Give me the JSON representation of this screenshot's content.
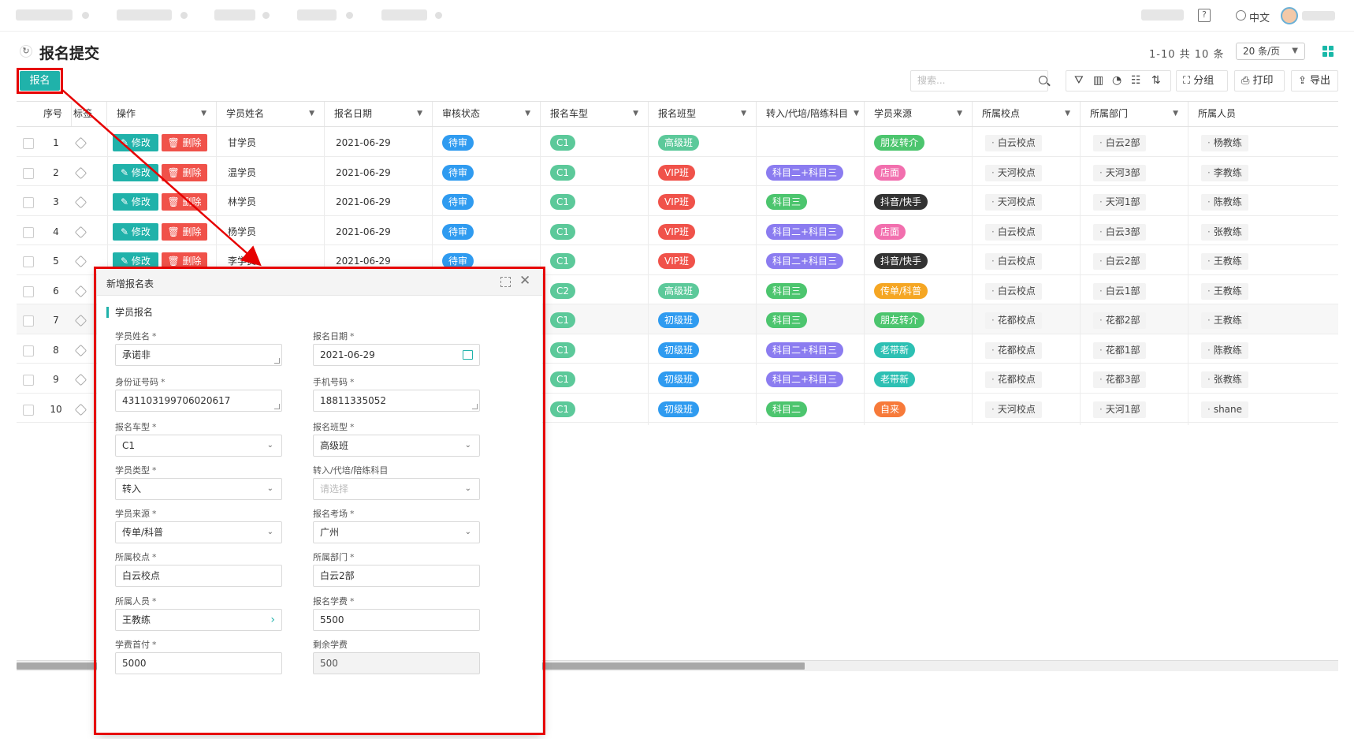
{
  "header": {
    "language": "中文",
    "help_glyph": "?"
  },
  "page": {
    "title": "报名提交",
    "paging_info": "1-10 共 10 条",
    "page_size": "20 条/页",
    "register_button": "报名"
  },
  "toolbar": {
    "search_placeholder": "搜索...",
    "group_label": "分组",
    "print_label": "打印",
    "export_label": "导出"
  },
  "table": {
    "columns": [
      "序号",
      "标签",
      "操作",
      "学员姓名",
      "报名日期",
      "审核状态",
      "报名车型",
      "报名班型",
      "转入/代培/陪练科目",
      "学员来源",
      "所属校点",
      "所属部门",
      "所属人员"
    ],
    "edit_label": "修改",
    "delete_label": "删除",
    "rows": [
      {
        "no": "1",
        "name": "甘学员",
        "date": "2021-06-29",
        "status": "待审",
        "car": "C1",
        "class": "高级班",
        "subject": "",
        "source": "朋友转介",
        "school": "白云校点",
        "dept": "白云2部",
        "person": "杨教练"
      },
      {
        "no": "2",
        "name": "温学员",
        "date": "2021-06-29",
        "status": "待审",
        "car": "C1",
        "class": "VIP班",
        "subject": "科目二+科目三",
        "source": "店面",
        "school": "天河校点",
        "dept": "天河3部",
        "person": "李教练"
      },
      {
        "no": "3",
        "name": "林学员",
        "date": "2021-06-29",
        "status": "待审",
        "car": "C1",
        "class": "VIP班",
        "subject": "科目三",
        "source": "抖音/快手",
        "school": "天河校点",
        "dept": "天河1部",
        "person": "陈教练"
      },
      {
        "no": "4",
        "name": "杨学员",
        "date": "2021-06-29",
        "status": "待审",
        "car": "C1",
        "class": "VIP班",
        "subject": "科目二+科目三",
        "source": "店面",
        "school": "白云校点",
        "dept": "白云3部",
        "person": "张教练"
      },
      {
        "no": "5",
        "name": "李学员",
        "date": "2021-06-29",
        "status": "待审",
        "car": "C1",
        "class": "VIP班",
        "subject": "科目二+科目三",
        "source": "抖音/快手",
        "school": "白云校点",
        "dept": "白云2部",
        "person": "王教练"
      },
      {
        "no": "6",
        "car": "C2",
        "class": "高级班",
        "subject": "科目三",
        "source": "传单/科普",
        "school": "白云校点",
        "dept": "白云1部",
        "person": "王教练"
      },
      {
        "no": "7",
        "car": "C1",
        "class": "初级班",
        "subject": "科目三",
        "source": "朋友转介",
        "school": "花都校点",
        "dept": "花都2部",
        "person": "王教练"
      },
      {
        "no": "8",
        "car": "C1",
        "class": "初级班",
        "subject": "科目二+科目三",
        "source": "老带新",
        "school": "花都校点",
        "dept": "花都1部",
        "person": "陈教练"
      },
      {
        "no": "9",
        "car": "C1",
        "class": "初级班",
        "subject": "科目二+科目三",
        "source": "老带新",
        "school": "花都校点",
        "dept": "花都3部",
        "person": "张教练"
      },
      {
        "no": "10",
        "car": "C1",
        "class": "初级班",
        "subject": "科目二",
        "source": "自来",
        "school": "天河校点",
        "dept": "天河1部",
        "person": "shane"
      }
    ]
  },
  "colors": {
    "teal": "#20b2aa",
    "red": "#f0524a",
    "vip": "#f0524a",
    "advanced": "#5cc99a",
    "beginner": "#2f9bf0",
    "subject": "#8b7cf0",
    "friend": "#4cc56e",
    "store": "#f26fae",
    "douyin": "#333333",
    "flyer": "#f5a623",
    "oldnew": "#2dc0b3",
    "self": "#f77a3a"
  },
  "dialog": {
    "title": "新增报名表",
    "section": "学员报名",
    "fields": {
      "name_label": "学员姓名",
      "name_value": "承诺非",
      "date_label": "报名日期",
      "date_value": "2021-06-29",
      "id_label": "身份证号码",
      "id_value": "431103199706020617",
      "phone_label": "手机号码",
      "phone_value": "18811335052",
      "car_label": "报名车型",
      "car_value": "C1",
      "class_label": "报名班型",
      "class_value": "高级班",
      "type_label": "学员类型",
      "type_value": "转入",
      "subject_label": "转入/代培/陪练科目",
      "subject_placeholder": "请选择",
      "source_label": "学员来源",
      "source_value": "传单/科普",
      "exam_label": "报名考场",
      "exam_value": "广州",
      "school_label": "所属校点",
      "school_value": "白云校点",
      "dept_label": "所属部门",
      "dept_value": "白云2部",
      "person_label": "所属人员",
      "person_value": "王教练",
      "fee_label": "报名学费",
      "fee_value": "5500",
      "first_pay_label": "学费首付",
      "first_pay_value": "5000",
      "remain_label": "剩余学费",
      "remain_value": "500"
    }
  }
}
